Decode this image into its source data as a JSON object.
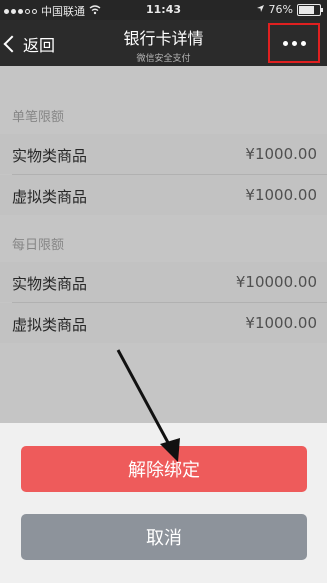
{
  "status_bar": {
    "carrier": "中国联通",
    "time": "11:43",
    "battery": "76%",
    "battery_level": 0.76
  },
  "nav": {
    "back_label": "返回",
    "title": "银行卡详情",
    "subtitle": "微信安全支付"
  },
  "limits": {
    "single": {
      "title": "单笔限额",
      "rows": [
        {
          "label": "实物类商品",
          "value": "¥1000.00"
        },
        {
          "label": "虚拟类商品",
          "value": "¥1000.00"
        }
      ]
    },
    "daily": {
      "title": "每日限额",
      "rows": [
        {
          "label": "实物类商品",
          "value": "¥10000.00"
        },
        {
          "label": "虚拟类商品",
          "value": "¥1000.00"
        }
      ]
    }
  },
  "sheet": {
    "unbind_label": "解除绑定",
    "cancel_label": "取消"
  },
  "colors": {
    "accent_red": "#ee5b5b",
    "highlight_border": "#e02020",
    "cancel_gray": "#8d939b"
  }
}
